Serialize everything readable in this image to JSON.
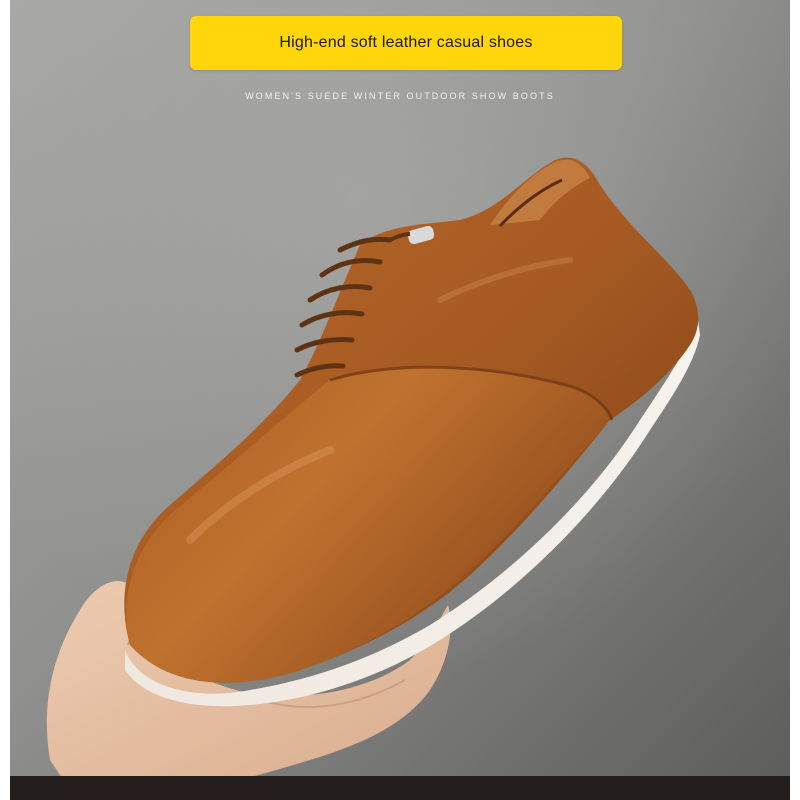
{
  "banner": {
    "title": "High-end soft leather casual shoes",
    "background_color": "#FFD60A"
  },
  "subtitle": "WOMEN'S SUEDE WINTER OUTDOOR SHOW BOOTS",
  "photo": {
    "subject_icon": "leather-shoe",
    "colors": {
      "wall_light": "#9E9E9C",
      "wall_dark": "#5E5E5C",
      "leather": "#A65A22",
      "leather_dark": "#6E3512",
      "sole": "#F1ECE6",
      "skin": "#E7C2A6",
      "bottom_band": "#241F1D"
    }
  }
}
